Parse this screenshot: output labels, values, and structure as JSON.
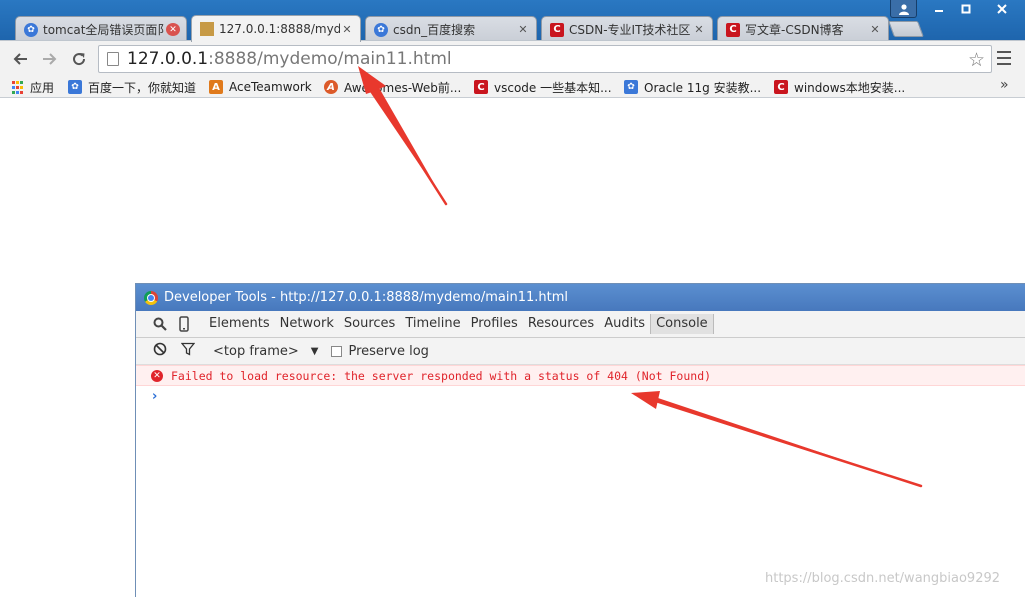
{
  "tabs": [
    {
      "title": "tomcat全局错误页面阝",
      "icon": "baidu-paw-icon",
      "active": false
    },
    {
      "title": "127.0.0.1:8888/myde",
      "icon": "tomcat-icon",
      "active": true
    },
    {
      "title": "csdn_百度搜索",
      "icon": "baidu-paw-icon",
      "active": false
    },
    {
      "title": "CSDN-专业IT技术社区",
      "icon": "csdn-icon",
      "active": false
    },
    {
      "title": "写文章-CSDN博客",
      "icon": "csdn-icon",
      "active": false
    }
  ],
  "toolbar": {
    "url_host": "127.0.0.1",
    "url_rest": ":8888/mydemo/main11.html"
  },
  "bookmarks": [
    {
      "label": "应用",
      "icon": "apps-icon"
    },
    {
      "label": "百度一下，你就知道",
      "icon": "baidu-paw-icon"
    },
    {
      "label": "AceTeamwork",
      "icon": "aceteamwork-icon"
    },
    {
      "label": "Awesomes-Web前...",
      "icon": "awesomes-icon"
    },
    {
      "label": "vscode 一些基本知...",
      "icon": "csdn-icon"
    },
    {
      "label": "Oracle 11g 安装教...",
      "icon": "baidu-paw-icon"
    },
    {
      "label": "windows本地安装...",
      "icon": "csdn-icon"
    }
  ],
  "bookmarks_more": "»",
  "devtools": {
    "title": "Developer Tools - http://127.0.0.1:8888/mydemo/main11.html",
    "tabs": [
      "Elements",
      "Network",
      "Sources",
      "Timeline",
      "Profiles",
      "Resources",
      "Audits",
      "Console"
    ],
    "selected_tab": "Console",
    "frame": "<top frame>",
    "preserve_log_label": "Preserve log",
    "preserve_log_checked": false,
    "error_message": "Failed to load resource: the server responded with a status of 404 (Not Found)",
    "prompt": "›"
  },
  "watermark": "https://blog.csdn.net/wangbiao9292",
  "colors": {
    "tabstrip": "#1e65ad",
    "error_text": "#e0242b",
    "error_bg": "#fff0f0",
    "arrow": "#e8382d",
    "devtools_title": "#4778bd"
  }
}
